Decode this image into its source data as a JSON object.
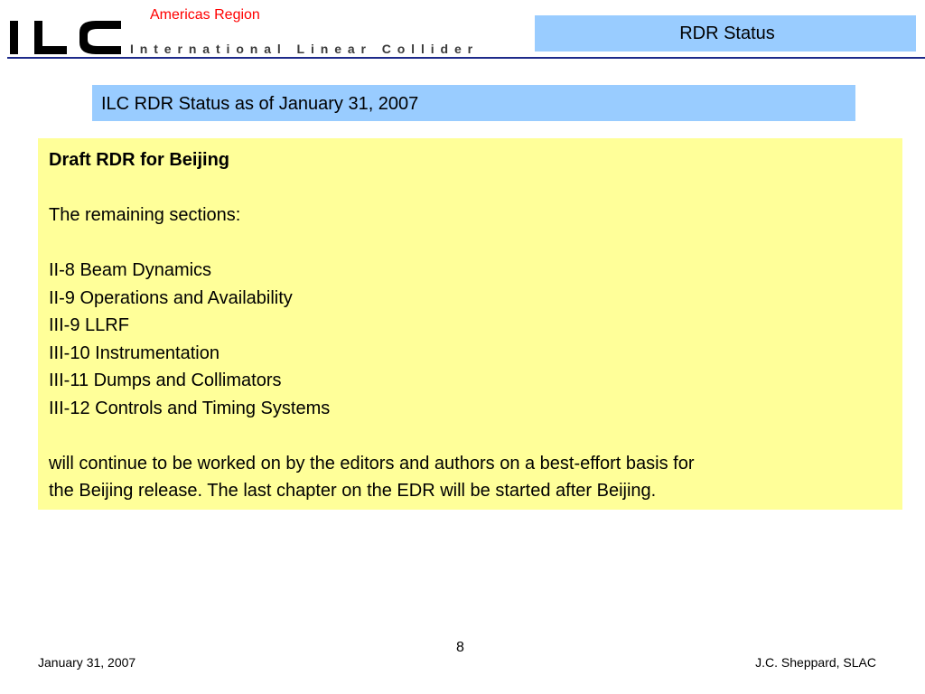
{
  "header": {
    "logo": {
      "wordmark": "ILC",
      "tagline": "International Linear Collider"
    },
    "region": "Americas Region",
    "section_title": "RDR Status"
  },
  "slide": {
    "heading": "ILC RDR Status as of January 31, 2007",
    "content": {
      "title": "Draft RDR for Beijing",
      "intro": "The remaining sections:",
      "sections": [
        "II-8 Beam Dynamics",
        "II-9 Operations and Availability",
        "III-9 LLRF",
        "III-10 Instrumentation",
        "III-11 Dumps and Collimators",
        "III-12 Controls and Timing Systems"
      ],
      "closing_line1": "will continue to be worked on by the editors and authors on a best-effort basis for",
      "closing_line2": "the Beijing release. The last chapter on the EDR will be started after Beijing."
    }
  },
  "footer": {
    "date": "January 31, 2007",
    "page_number": "8",
    "author": "J.C. Sheppard, SLAC"
  },
  "colors": {
    "title_box": "#99ccff",
    "content_box": "#ffff99",
    "region_text": "#ff0000",
    "logo": "#000000",
    "header_rule": "#1e2a8a"
  }
}
